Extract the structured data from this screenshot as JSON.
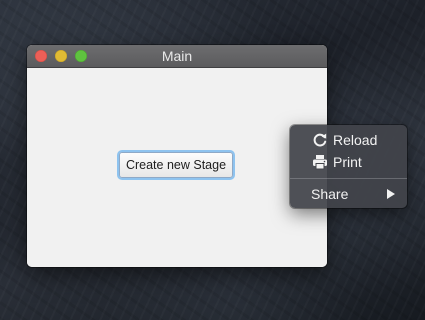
{
  "window": {
    "title": "Main",
    "controls": {
      "close": "close-button",
      "minimize": "minimize-button",
      "maximize": "maximize-button"
    },
    "button_label": "Create new Stage"
  },
  "context_menu": {
    "items": [
      {
        "label": "Reload",
        "icon": "reload-icon"
      },
      {
        "label": "Print",
        "icon": "printer-icon"
      },
      {
        "label": "Share",
        "icon": "submenu-arrow-icon"
      }
    ]
  },
  "colors": {
    "close": "#ec5f57",
    "minimize": "#e0bb34",
    "maximize": "#5fc23f",
    "button_focus": "#8ec3ef",
    "menu_background": "#42444a"
  }
}
